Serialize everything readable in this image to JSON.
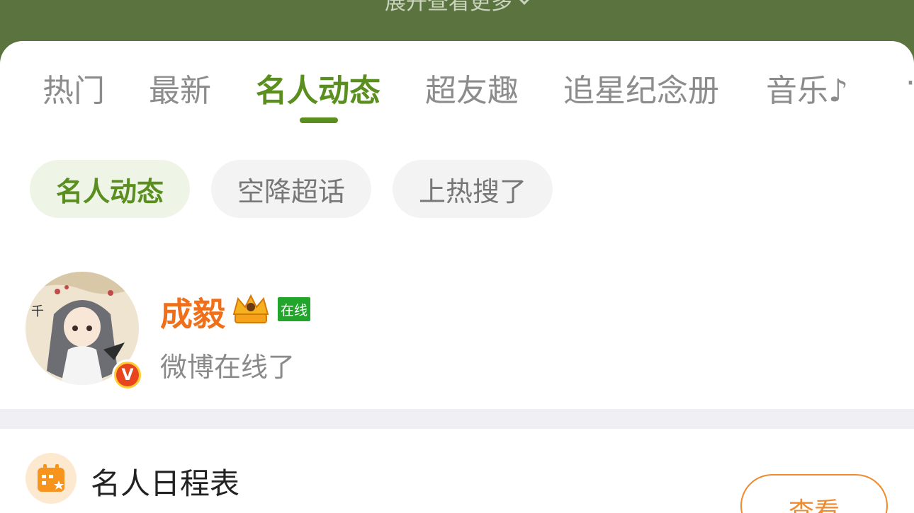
{
  "header": {
    "expand_label": "展开查看更多"
  },
  "tabs": [
    {
      "label": "热门"
    },
    {
      "label": "最新"
    },
    {
      "label": "名人动态",
      "active": true
    },
    {
      "label": "超友趣"
    },
    {
      "label": "追星纪念册"
    },
    {
      "label": "音乐♪"
    }
  ],
  "chips": [
    {
      "label": "名人动态",
      "active": true
    },
    {
      "label": "空降超话"
    },
    {
      "label": "上热搜了"
    }
  ],
  "feed_item": {
    "user_name": "成毅",
    "online_badge": "在线",
    "status_text": "微博在线了",
    "verified_badge": "V"
  },
  "schedule": {
    "title": "名人日程表",
    "view_button": "查看"
  },
  "colors": {
    "accent_green": "#5a8f1f",
    "header_green": "#5b733f",
    "orange": "#f06f1a",
    "online_green": "#21a62b"
  }
}
